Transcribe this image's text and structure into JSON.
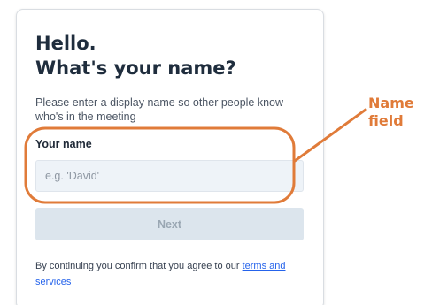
{
  "card": {
    "title_line1": "Hello.",
    "title_line2": "What's your name?",
    "description": "Please enter a display name so other people know who's in the meeting",
    "name_label": "Your name",
    "name_placeholder": "e.g. 'David'",
    "name_value": "",
    "next_label": "Next",
    "terms_prefix": "By continuing you confirm that you agree to our ",
    "terms_link": "terms and services"
  },
  "annotation": {
    "line1": "Name",
    "line2": "field",
    "color": "#e07b39"
  },
  "colors": {
    "title": "#1f2d3d",
    "input_bg": "#eef3f8",
    "button_disabled_bg": "#dce5ed",
    "button_disabled_text": "#9aa7b3",
    "link": "#2563eb"
  }
}
